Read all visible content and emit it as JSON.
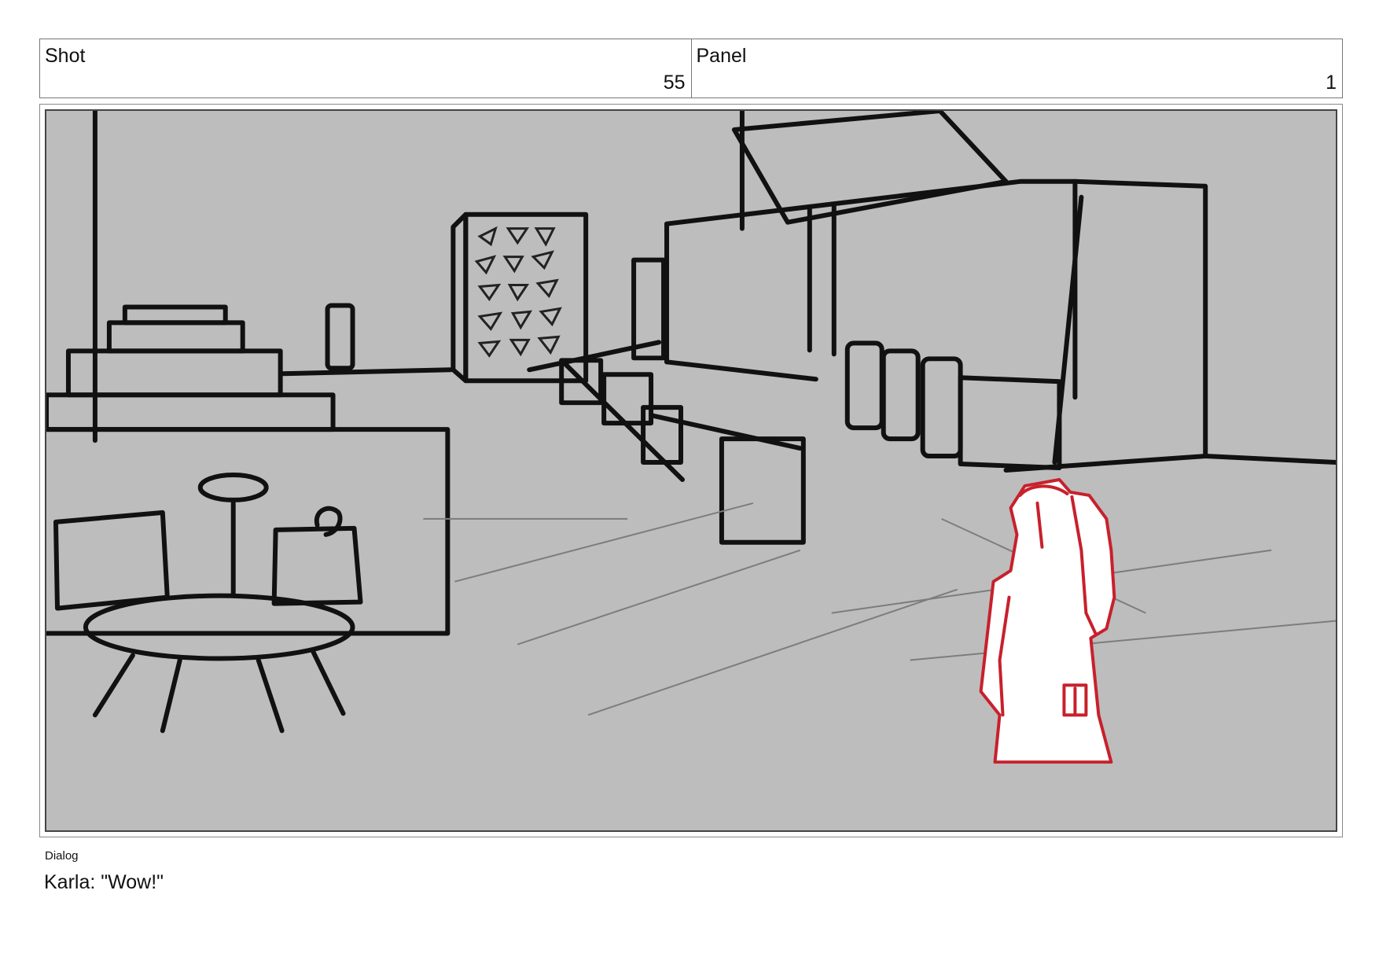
{
  "shot": {
    "label": "Shot",
    "value": "55"
  },
  "panel": {
    "label": "Panel",
    "value": "1"
  },
  "dialog": {
    "label": "Dialog",
    "text": "Karla: \"Wow!\""
  },
  "colors": {
    "panel_background": "#bdbdbd",
    "sketch_line": "#111111",
    "character_line": "#c8202c"
  }
}
